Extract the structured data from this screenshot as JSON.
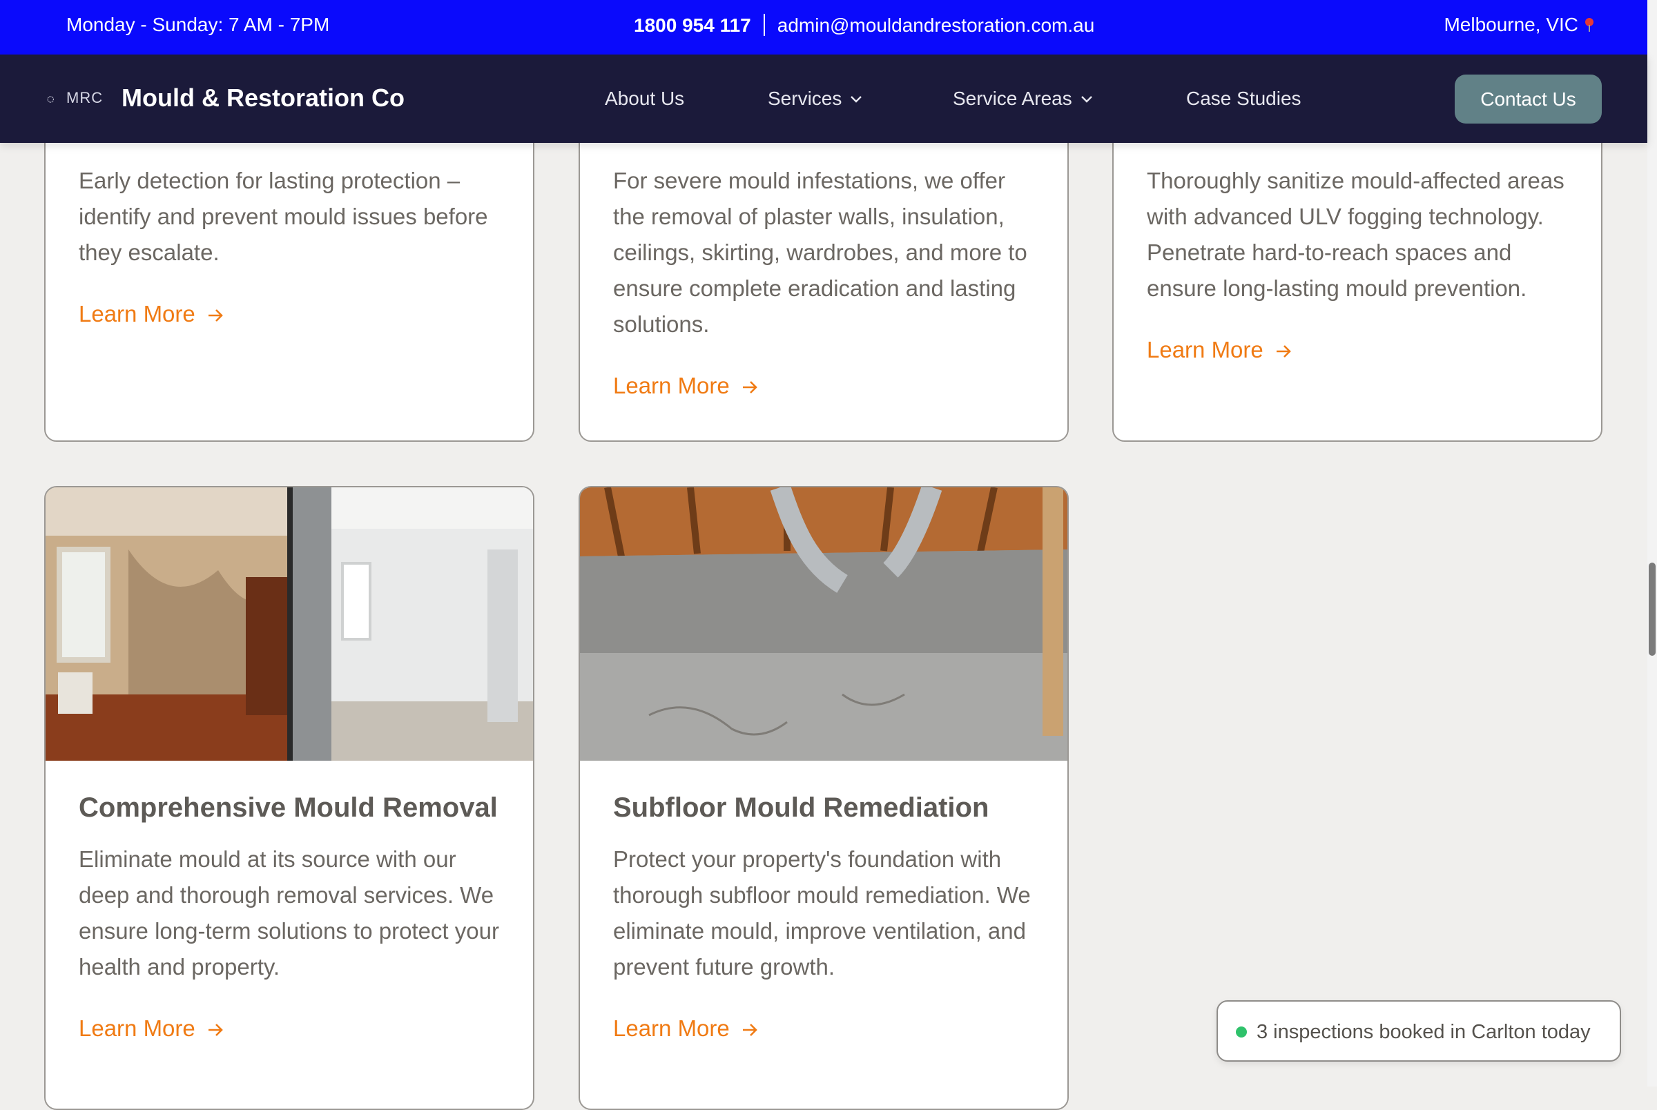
{
  "topbar": {
    "hours": "Monday - Sunday: 7 AM - 7PM",
    "phone": "1800 954 117",
    "email": "admin@mouldandrestoration.com.au",
    "location": "Melbourne, VIC",
    "location_icon": "map-pin-icon"
  },
  "navbar": {
    "logo_mark": "MRC",
    "brand": "Mould & Restoration Co",
    "items": [
      {
        "label": "About Us"
      },
      {
        "label": "Services"
      },
      {
        "label": "Service Areas"
      },
      {
        "label": "Case Studies"
      }
    ],
    "cta": "Contact Us"
  },
  "cards_row1": [
    {
      "description": "Early detection for lasting protection – identify and prevent mould issues before they escalate.",
      "link": "Learn More"
    },
    {
      "description": "For severe mould infestations, we offer the removal of plaster walls, insulation, ceilings, skirting, wardrobes, and more to ensure complete eradication and lasting solutions.",
      "link": "Learn More"
    },
    {
      "description": "Thoroughly sanitize mould-affected areas with advanced ULV fogging technology. Penetrate hard-to-reach spaces and ensure long-lasting mould prevention.",
      "link": "Learn More"
    }
  ],
  "cards_row2": [
    {
      "title": "Comprehensive Mould Removal",
      "description": "Eliminate mould at its source with our deep and thorough removal services. We ensure long-term solutions to protect your health and property.",
      "link": "Learn More"
    },
    {
      "title": "Subfloor Mould Remediation",
      "description": "Protect your property's foundation with thorough subfloor mould remediation. We eliminate mould, improve ventilation, and prevent future growth.",
      "link": "Learn More"
    }
  ],
  "toast": {
    "text": "3 inspections booked in Carlton today",
    "status_color": "#2fc26b"
  },
  "colors": {
    "topbar": "#0a0afc",
    "navbar": "#1b1a3a",
    "cta": "#618187",
    "link": "#f07b14",
    "background": "#f0efed"
  }
}
